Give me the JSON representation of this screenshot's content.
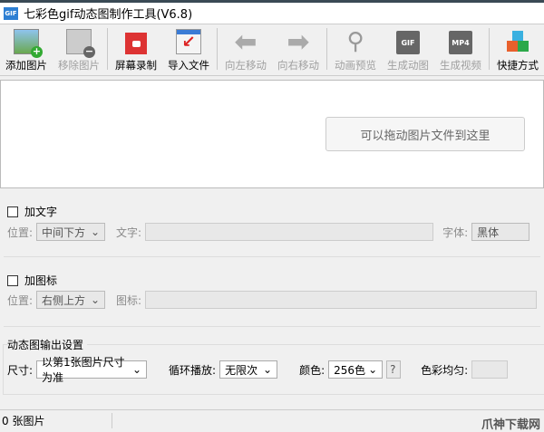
{
  "window": {
    "title": "七彩色gif动态图制作工具(V6.8)",
    "icon_text": "GIF"
  },
  "toolbar": [
    {
      "label": "添加图片",
      "icon": "add-image-icon",
      "enabled": true
    },
    {
      "label": "移除图片",
      "icon": "remove-image-icon",
      "enabled": false
    },
    {
      "label": "屏幕录制",
      "icon": "screen-record-icon",
      "enabled": true
    },
    {
      "label": "导入文件",
      "icon": "import-file-icon",
      "enabled": true
    },
    {
      "label": "向左移动",
      "icon": "arrow-left-icon",
      "enabled": false
    },
    {
      "label": "向右移动",
      "icon": "arrow-right-icon",
      "enabled": false
    },
    {
      "label": "动画预览",
      "icon": "magnifier-icon",
      "enabled": false
    },
    {
      "label": "生成动图",
      "icon": "gif-icon",
      "enabled": false,
      "icon_text": "GIF"
    },
    {
      "label": "生成视频",
      "icon": "mp4-icon",
      "enabled": false,
      "icon_text": "MP4"
    },
    {
      "label": "快捷方式",
      "icon": "cubes-icon",
      "enabled": true
    }
  ],
  "drop_hint": "可以拖动图片文件到这里",
  "text_section": {
    "checkbox": "加文字",
    "position_label": "位置:",
    "position_value": "中间下方",
    "text_label": "文字:",
    "font_label": "字体:",
    "font_value": "黑体"
  },
  "icon_section": {
    "checkbox": "加图标",
    "position_label": "位置:",
    "position_value": "右侧上方",
    "icon_label": "图标:"
  },
  "output": {
    "title": "动态图输出设置",
    "size_label": "尺寸:",
    "size_value": "以第1张图片尺寸为准",
    "loop_label": "循环播放:",
    "loop_value": "无限次",
    "color_label": "颜色:",
    "color_value": "256色",
    "help": "?",
    "balance_label": "色彩均匀:"
  },
  "status": {
    "count": "0 张图片"
  },
  "watermark": "爪神下载网"
}
